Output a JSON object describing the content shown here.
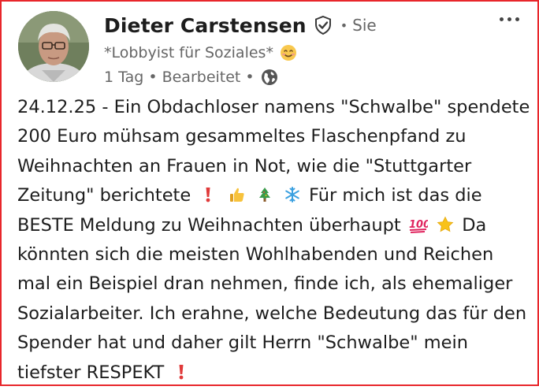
{
  "post": {
    "author": {
      "name": "Dieter Carstensen",
      "badge_icon": "verified-shield-icon",
      "relation": "Sie",
      "headline": "*Lobbyist für Soziales*",
      "headline_emoji": "smiling-face-icon"
    },
    "meta": {
      "time_edited": "1 Tag • Bearbeitet •",
      "visibility_icon": "globe-icon"
    },
    "menu_icon": "more-options-icon",
    "text": {
      "l1": "24.12.25 - Ein Obdachloser namens \"Schwalbe\" spendete",
      "l2": "200 Euro mühsam gesammeltes Flaschenpfand zu",
      "l3": "Weihnachten an Frauen in Not, wie die \"Stuttgarter",
      "l4": "Zeitung\" berichtete",
      "l4b": "Für mich ist das die",
      "l5": "BESTE Meldung zu Weihnachten überhaupt",
      "l5b": "Da",
      "l6": "könnten sich die meisten Wohlhabenden und Reichen",
      "l7": "mal ein Beispiel dran nehmen, finde ich, als ehemaliger",
      "l8": "Sozialarbeiter. Ich erahne, welche Bedeutung das für den",
      "l9": "Spender hat und daher gilt Herrn \"Schwalbe\" mein",
      "l10": "tiefster RESPEKT"
    },
    "emojis": {
      "line4": [
        "exclamation-icon",
        "thumbs-up-icon",
        "christmas-tree-icon",
        "snowflake-icon"
      ],
      "line5": [
        "hundred-points-icon",
        "star-icon"
      ],
      "line10": [
        "exclamation-icon"
      ]
    }
  },
  "colors": {
    "frame_border": "#e8262b",
    "text": "#1d1d1d",
    "muted": "#666666"
  }
}
